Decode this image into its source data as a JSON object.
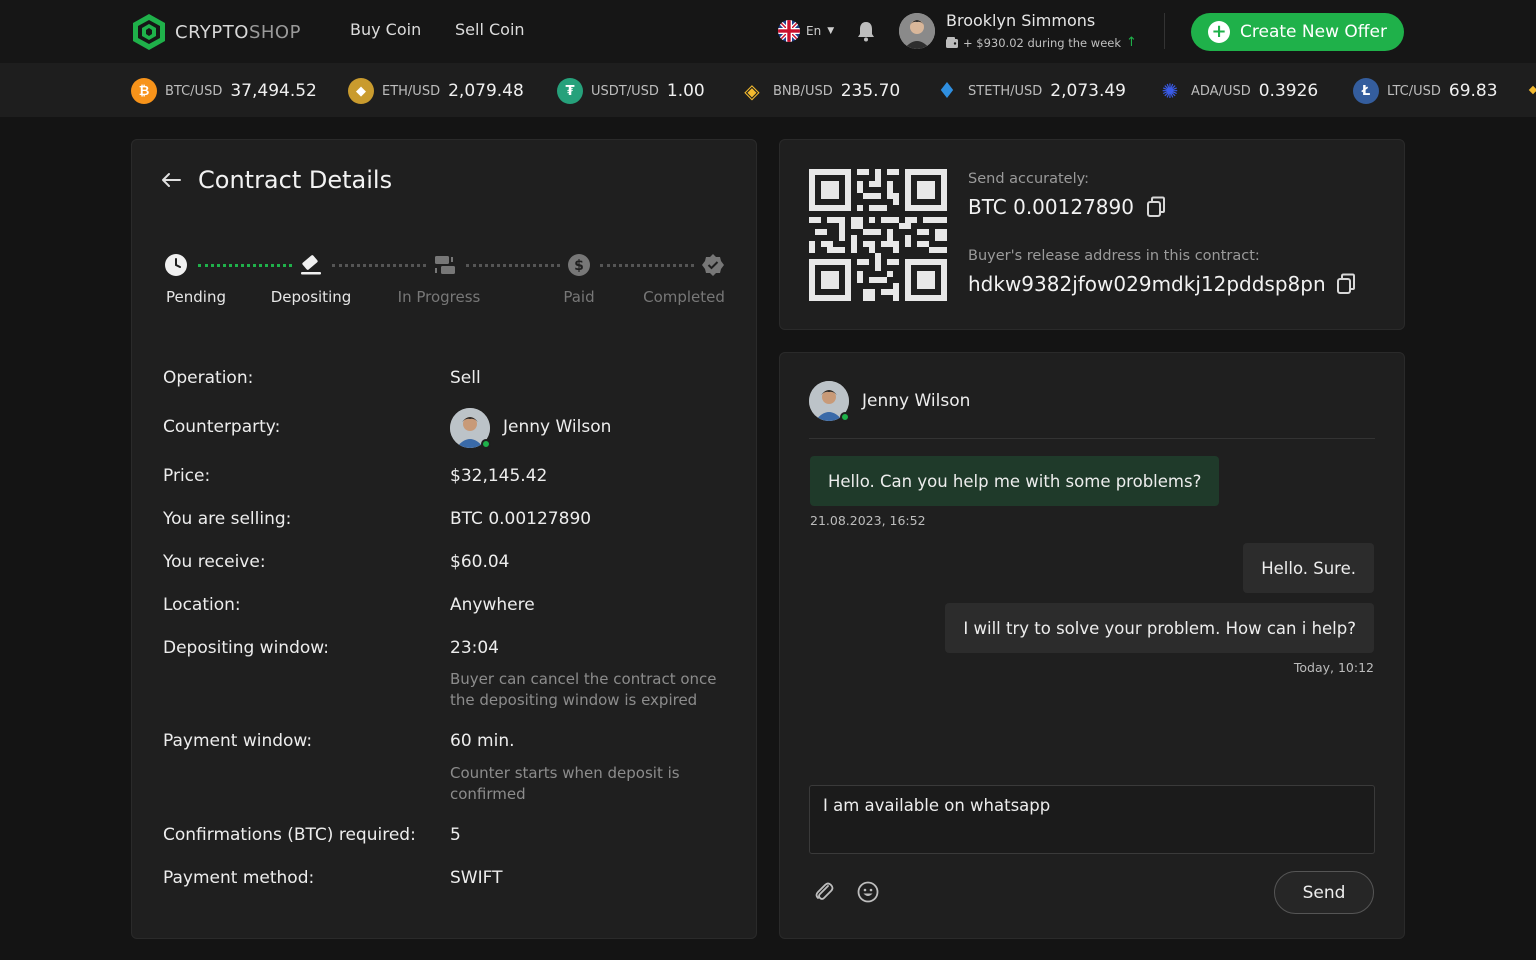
{
  "brand": {
    "name_main": "CRYPTO",
    "name_sub": "SHOP"
  },
  "nav": {
    "buy": "Buy Coin",
    "sell": "Sell Coin"
  },
  "language": "En",
  "user": {
    "name": "Brooklyn Simmons",
    "stat": "+ $930.02 during the week"
  },
  "cta_label": "Create New Offer",
  "ticker": [
    {
      "pair": "BTC/USD",
      "price": "37,494.52",
      "color": "#f7931a",
      "symbol": "₿"
    },
    {
      "pair": "ETH/USD",
      "price": "2,079.48",
      "color": "#c99b2e",
      "symbol": "◆"
    },
    {
      "pair": "USDT/USD",
      "price": "1.00",
      "color": "#26a17b",
      "symbol": "₮"
    },
    {
      "pair": "BNB/USD",
      "price": "235.70",
      "color": "#f3ba2f",
      "symbol": "◈"
    },
    {
      "pair": "STETH/USD",
      "price": "2,073.49",
      "color": "#2f8fe0",
      "symbol": "♦"
    },
    {
      "pair": "ADA/USD",
      "price": "0.3926",
      "color": "#2a4bd7",
      "symbol": "✺"
    },
    {
      "pair": "LTC/USD",
      "price": "69.83",
      "color": "#345d9d",
      "symbol": "Ł"
    }
  ],
  "contract": {
    "title": "Contract Details",
    "steps": [
      {
        "label": "Pending",
        "done": true
      },
      {
        "label": "Depositing",
        "done": true
      },
      {
        "label": "In Progress",
        "done": false
      },
      {
        "label": "Paid",
        "done": false
      },
      {
        "label": "Completed",
        "done": false
      }
    ],
    "rows": {
      "operation": {
        "label": "Operation:",
        "value": "Sell"
      },
      "counterparty": {
        "label": "Counterparty:",
        "value": "Jenny Wilson"
      },
      "price": {
        "label": "Price:",
        "value": "$32,145.42"
      },
      "selling": {
        "label": "You are selling:",
        "value": "BTC 0.00127890"
      },
      "receive": {
        "label": "You receive:",
        "value": "$60.04"
      },
      "location": {
        "label": "Location:",
        "value": "Anywhere"
      },
      "deposit_window": {
        "label": "Depositing window:",
        "value": "23:04",
        "note": "Buyer can cancel the contract once the depositing window is expired"
      },
      "payment_window": {
        "label": "Payment window:",
        "value": "60 min.",
        "note": "Counter starts when deposit is confirmed"
      },
      "confirmations": {
        "label": "Confirmations (BTC) required:",
        "value": "5"
      },
      "method": {
        "label": "Payment method:",
        "value": "SWIFT"
      }
    }
  },
  "deposit": {
    "send_label": "Send accurately:",
    "amount": "BTC 0.00127890",
    "address_label": "Buyer's release address in this contract:",
    "address": "hdkw9382jfow029mdkj12pddsp8pn"
  },
  "chat": {
    "name": "Jenny Wilson",
    "messages": [
      {
        "text": "Hello. Can you help me with some problems?"
      },
      {
        "text": "Hello. Sure."
      },
      {
        "text": "I will try to solve your problem. How can i help?"
      }
    ],
    "ts_in": "21.08.2023, 16:52",
    "ts_out": "Today, 10:12",
    "input_value": "I am available on whatsapp",
    "send_label": "Send"
  }
}
